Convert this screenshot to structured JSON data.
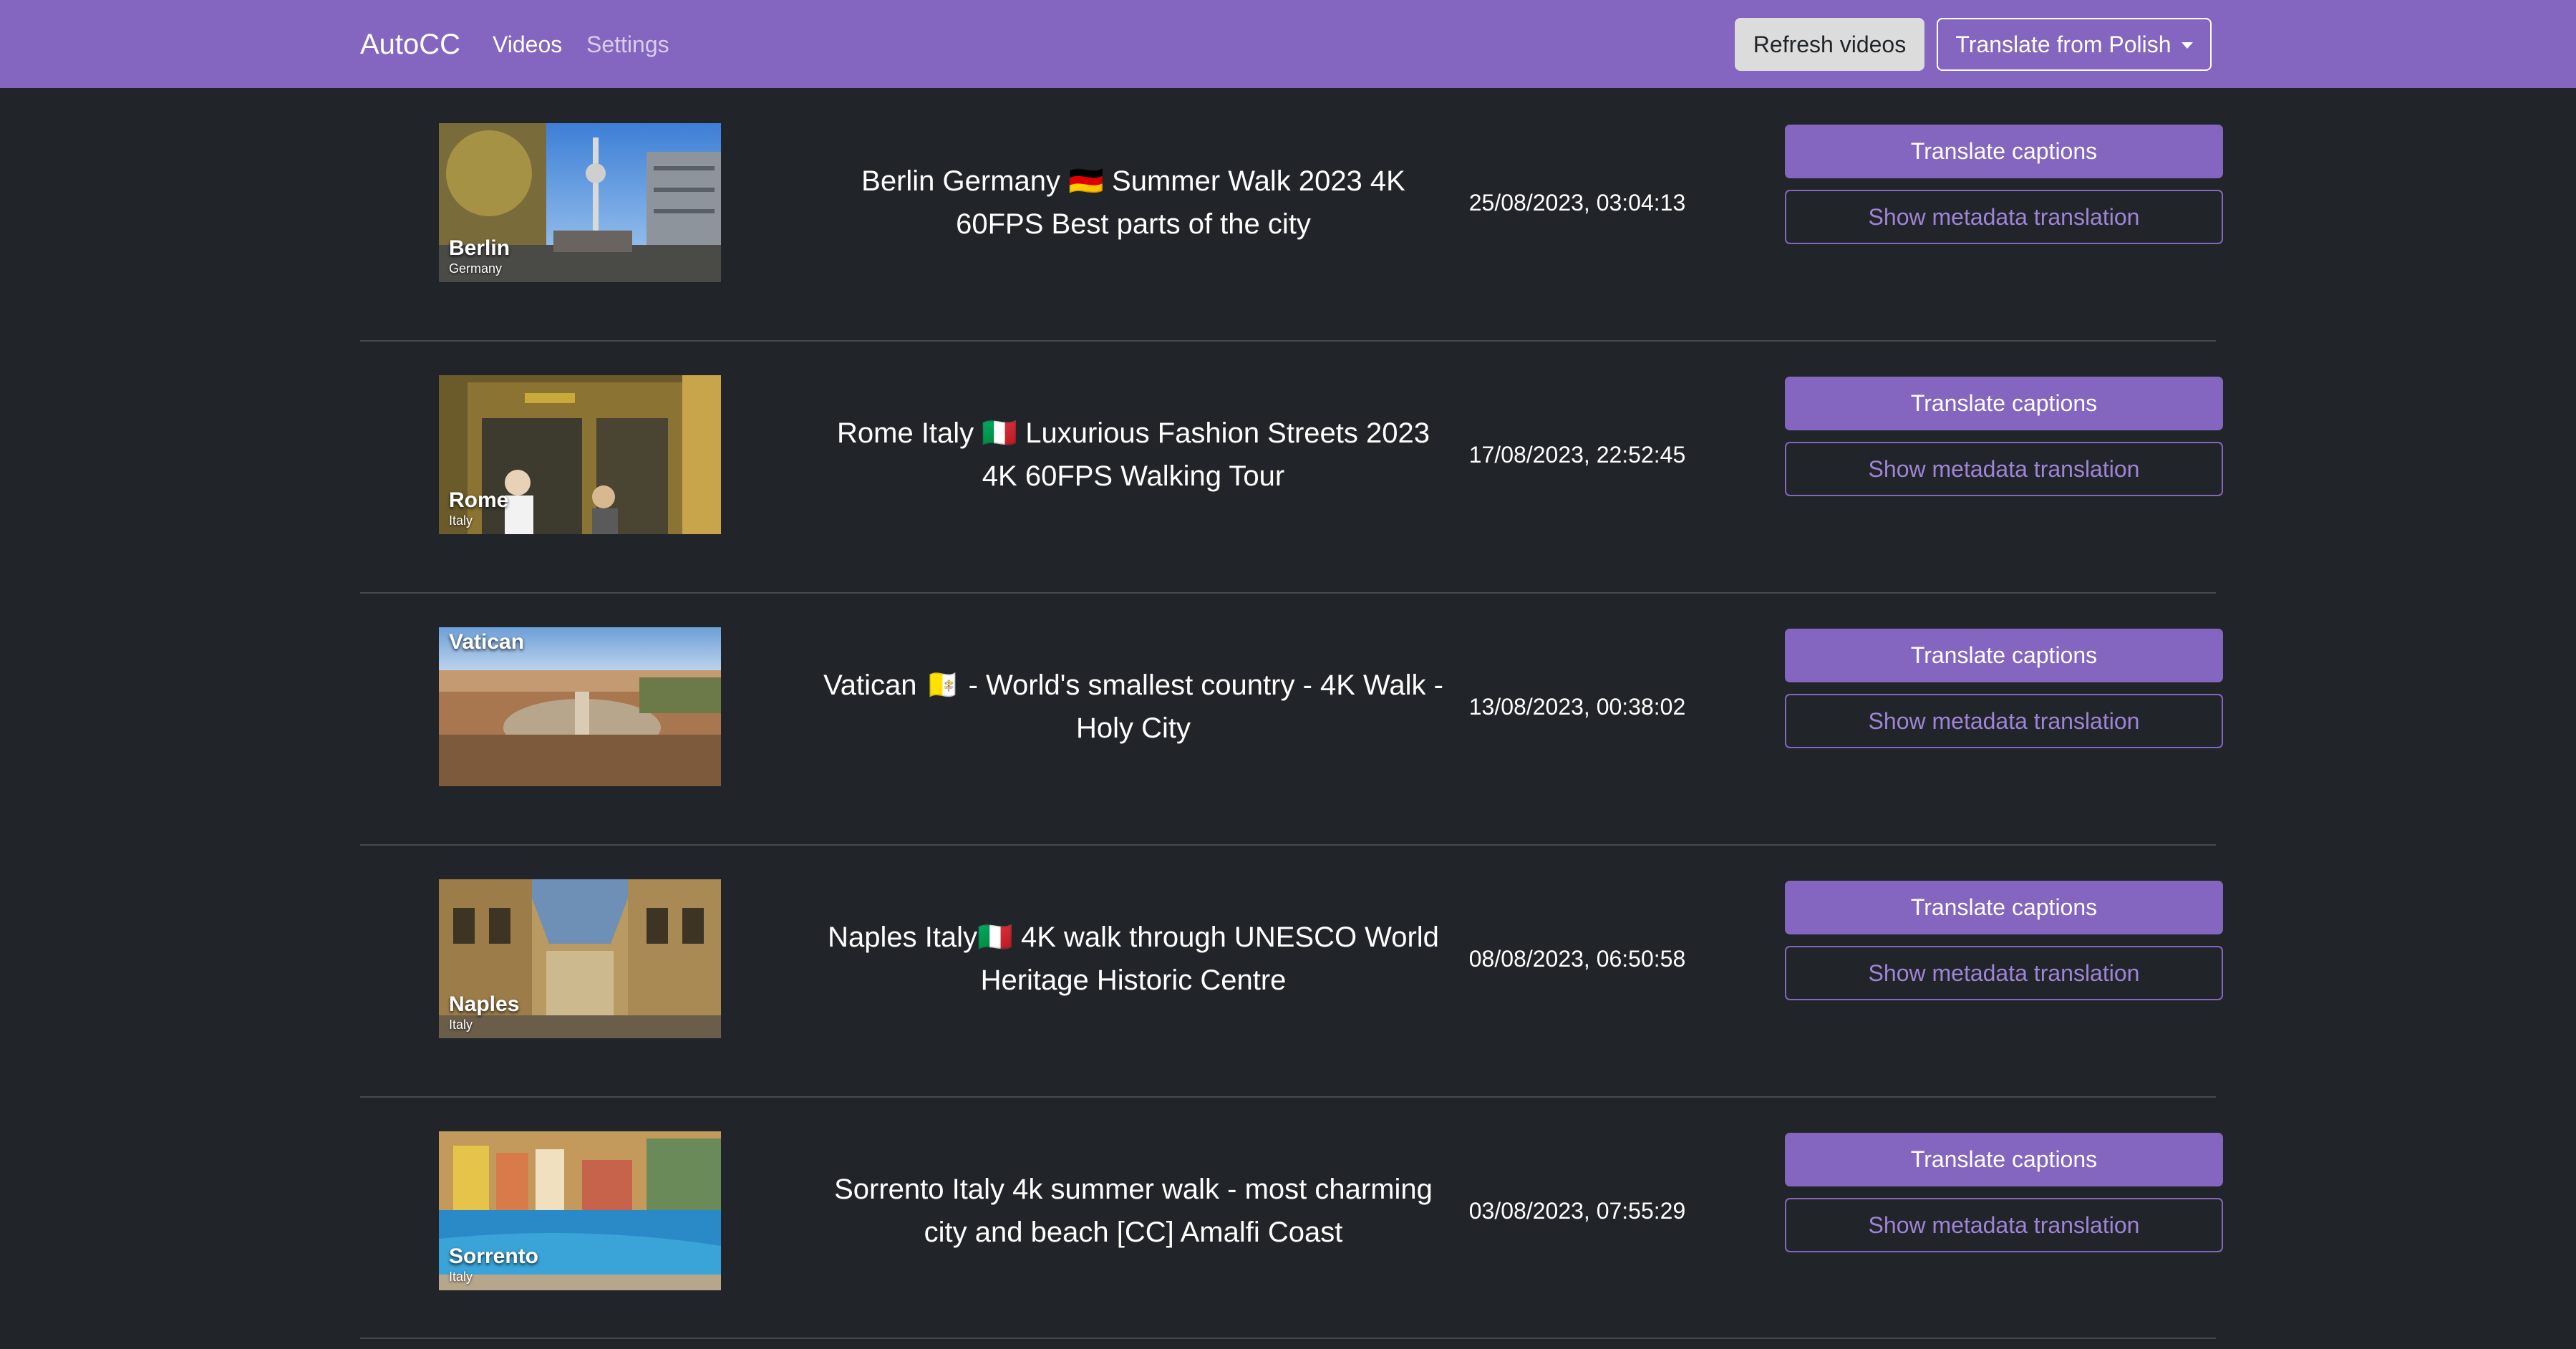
{
  "navbar": {
    "brand": "AutoCC",
    "links": [
      "Videos",
      "Settings"
    ],
    "refresh_label": "Refresh videos",
    "translate_from_label": "Translate from Polish"
  },
  "videos": [
    {
      "thumb_city": "Berlin",
      "thumb_country": "Germany",
      "title": "Berlin Germany 🇩🇪 Summer Walk 2023 4K 60FPS Best parts of the city",
      "date": "25/08/2023, 03:04:13",
      "translate_label": "Translate captions",
      "metadata_label": "Show metadata translation"
    },
    {
      "thumb_city": "Rome",
      "thumb_country": "Italy",
      "title": "Rome Italy 🇮🇹 Luxurious Fashion Streets 2023 4K 60FPS Walking Tour",
      "date": "17/08/2023, 22:52:45",
      "translate_label": "Translate captions",
      "metadata_label": "Show metadata translation"
    },
    {
      "thumb_city": "Vatican",
      "thumb_country": "",
      "title": "Vatican 🇻🇦 - World's smallest country - 4K Walk - Holy City",
      "date": "13/08/2023, 00:38:02",
      "translate_label": "Translate captions",
      "metadata_label": "Show metadata translation"
    },
    {
      "thumb_city": "Naples",
      "thumb_country": "Italy",
      "title": "Naples Italy🇮🇹 4K walk through UNESCO World Heritage Historic Centre",
      "date": "08/08/2023, 06:50:58",
      "translate_label": "Translate captions",
      "metadata_label": "Show metadata translation"
    },
    {
      "thumb_city": "Sorrento",
      "thumb_country": "Italy",
      "title": "Sorrento Italy 4k summer walk - most charming city and beach [CC] Amalfi Coast",
      "date": "03/08/2023, 07:55:29",
      "translate_label": "Translate captions",
      "metadata_label": "Show metadata translation"
    }
  ],
  "colors": {
    "accent": "#8465c0",
    "background": "#212529"
  }
}
